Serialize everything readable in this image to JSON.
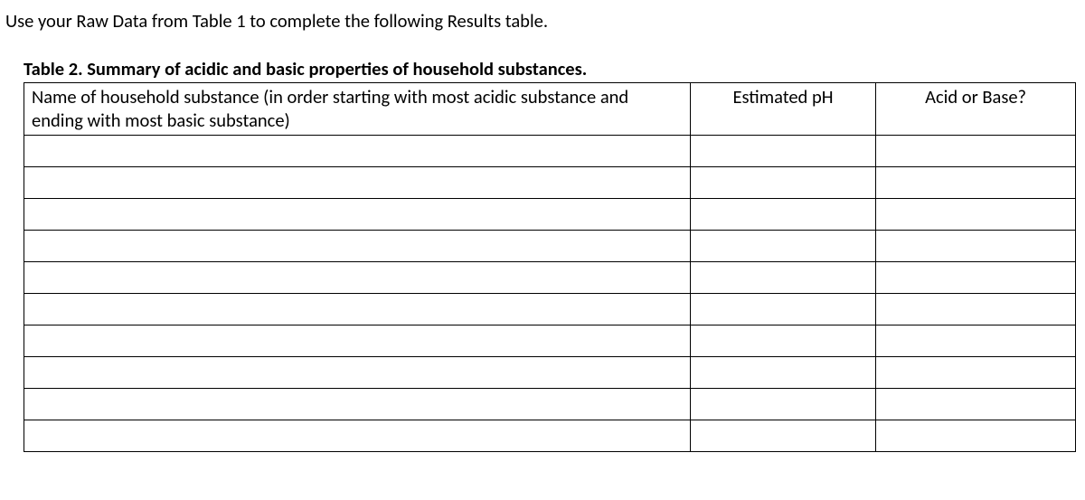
{
  "instruction": "Use your Raw Data from Table 1 to complete the following Results table.",
  "caption": "Table 2. Summary of acidic and basic properties of household substances.",
  "headers": {
    "substance": "Name of household substance (in order starting with most acidic substance and ending with most basic substance)",
    "ph": "Estimated pH",
    "acid_base": "Acid or Base?"
  },
  "rows": [
    {
      "substance": "",
      "ph": "",
      "acid_base": ""
    },
    {
      "substance": "",
      "ph": "",
      "acid_base": ""
    },
    {
      "substance": "",
      "ph": "",
      "acid_base": ""
    },
    {
      "substance": "",
      "ph": "",
      "acid_base": ""
    },
    {
      "substance": "",
      "ph": "",
      "acid_base": ""
    },
    {
      "substance": "",
      "ph": "",
      "acid_base": ""
    },
    {
      "substance": "",
      "ph": "",
      "acid_base": ""
    },
    {
      "substance": "",
      "ph": "",
      "acid_base": ""
    },
    {
      "substance": "",
      "ph": "",
      "acid_base": ""
    },
    {
      "substance": "",
      "ph": "",
      "acid_base": ""
    }
  ]
}
